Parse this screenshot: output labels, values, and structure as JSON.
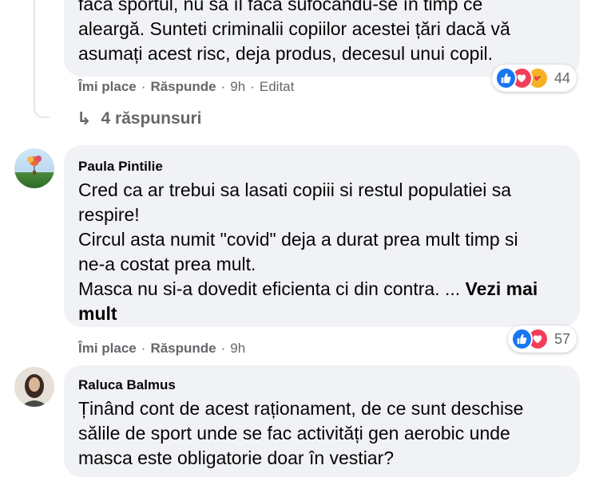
{
  "comment_top": {
    "lines": [
      "facă sportul, nu să îl facă sufocându-se în timp ce",
      "aleargă. Sunteti criminalii copiilor acestei țări dacă vă",
      "asumați acest risc, deja produs, decesul unui copil."
    ],
    "like_label": "Îmi place",
    "reply_label": "Răspunde",
    "time": "9h",
    "edited": "Editat",
    "reaction_count": "44",
    "reactions": [
      "like-icon",
      "love-icon",
      "care-icon"
    ]
  },
  "replies_link": {
    "label": "4 răspunsuri",
    "icon": "reply-arrow-icon"
  },
  "comment_paula": {
    "author": "Paula Pintilie",
    "lines": [
      "Cred ca ar trebui sa lasati copiii si restul populatiei sa",
      "respire!",
      "Circul asta numit \"covid\" deja a durat prea mult timp si",
      "ne-a costat prea mult.",
      "Masca nu si-a dovedit eficienta ci din contra. ... "
    ],
    "see_more_a": "Vezi mai",
    "see_more_b": "mult",
    "like_label": "Îmi place",
    "reply_label": "Răspunde",
    "time": "9h",
    "reaction_count": "57",
    "reactions": [
      "like-icon",
      "love-icon"
    ]
  },
  "comment_raluca": {
    "author": "Raluca Balmus",
    "lines": [
      "Ținând cont de acest raționament, de ce sunt deschise",
      "sălile de sport unde se fac activități gen aerobic unde",
      "masca este obligatorie doar în vestiar?"
    ]
  },
  "separator": "·",
  "colors": {
    "bubble": "#f0f2f5",
    "meta": "#65676b",
    "like": "#1877f2",
    "love": "#f33e58",
    "care": "#f7b125"
  }
}
